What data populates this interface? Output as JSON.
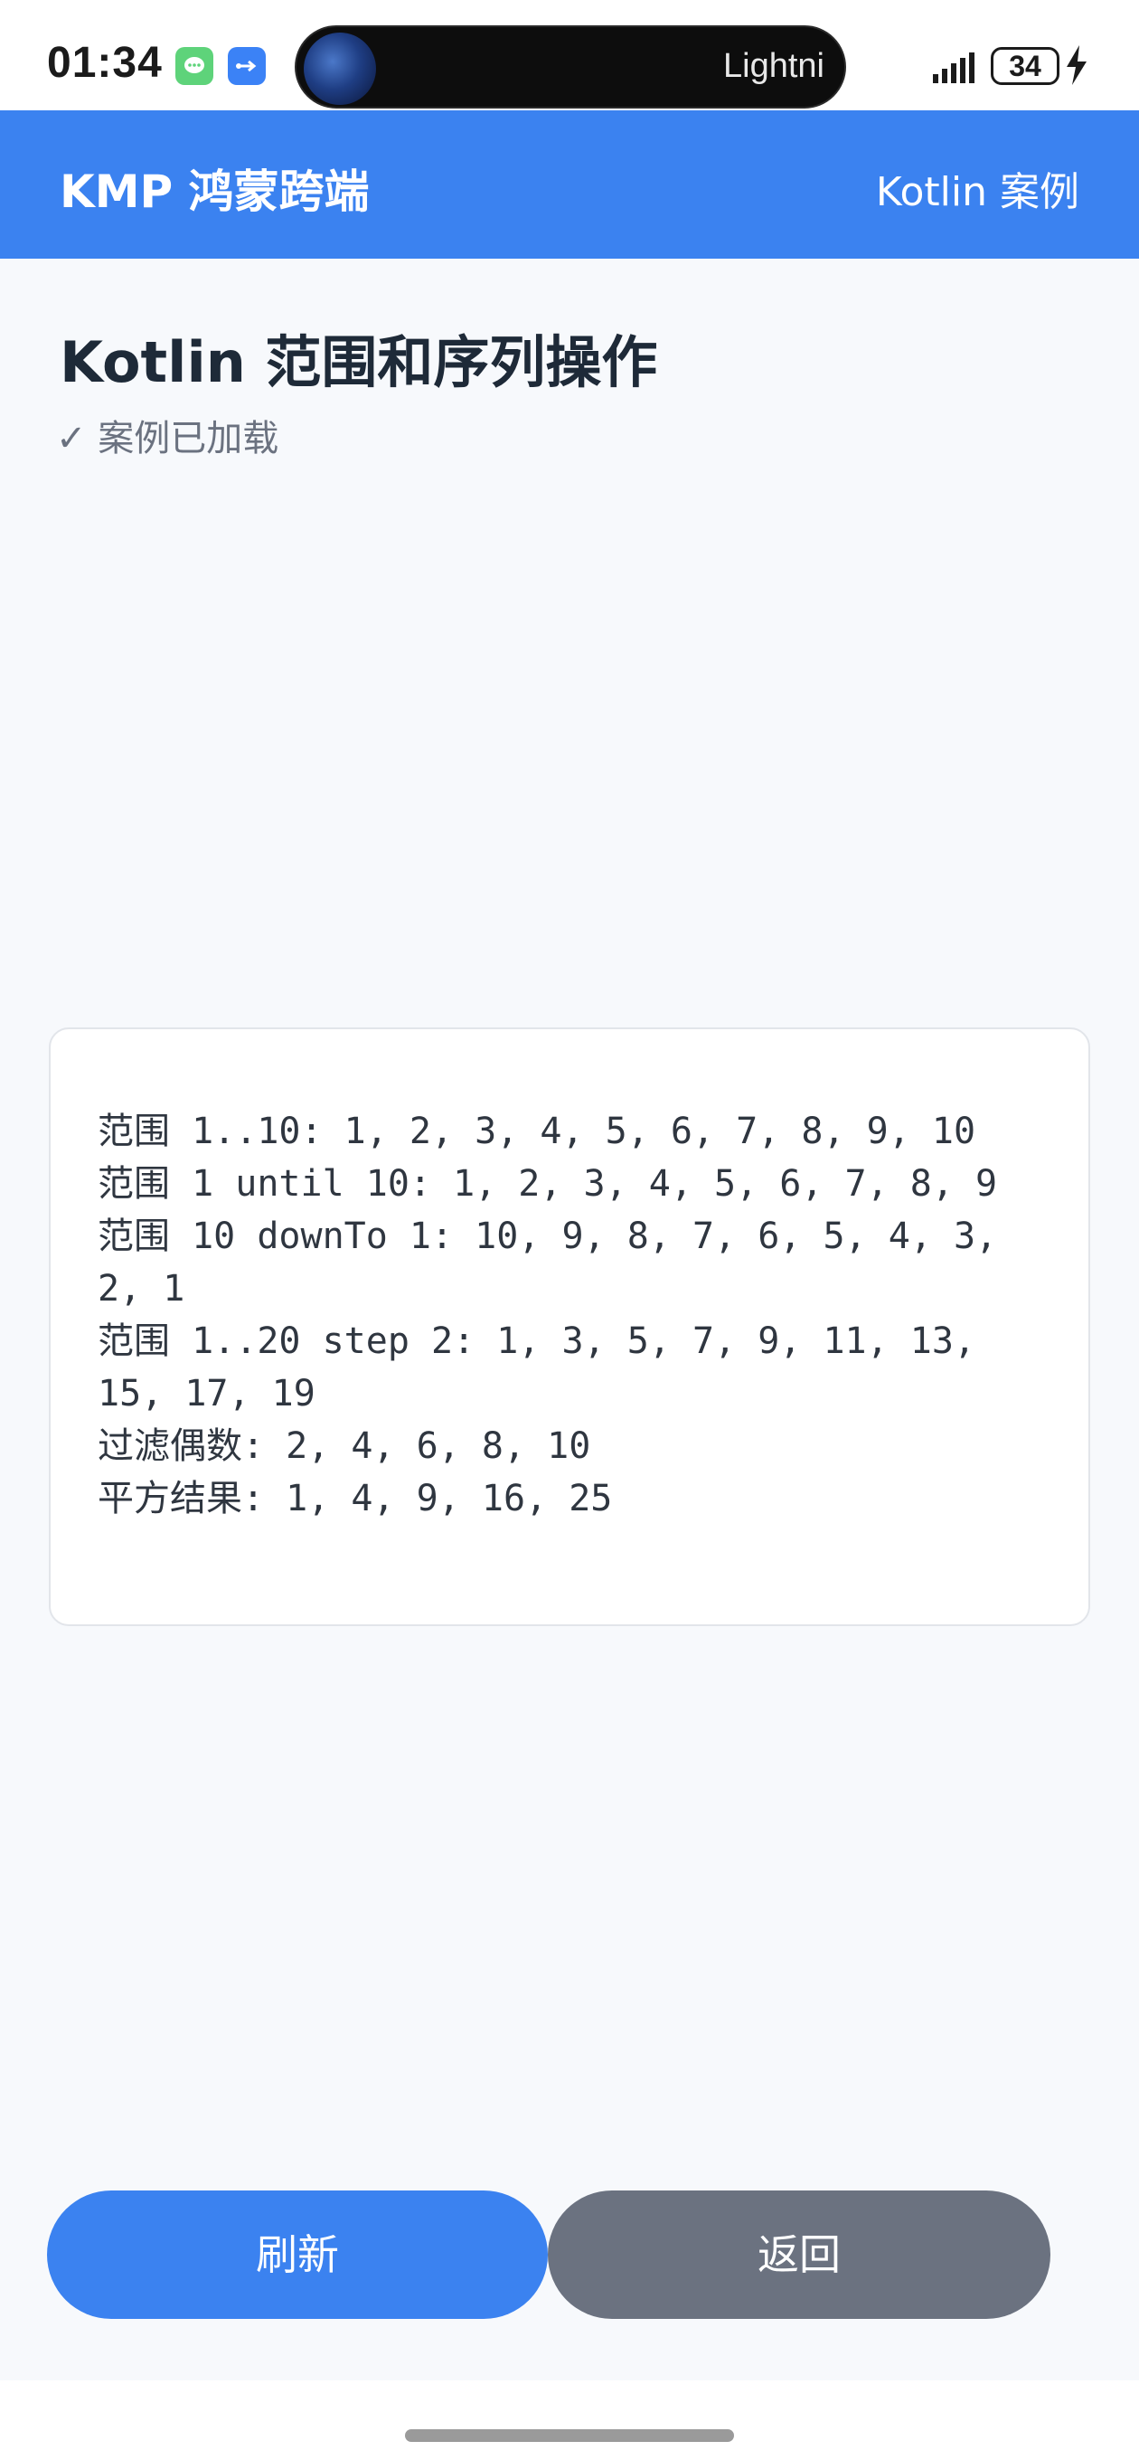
{
  "status_bar": {
    "time": "01:34",
    "island_text": "Lightni",
    "battery": "34",
    "icons": [
      "message-icon",
      "usb-icon",
      "signal-icon",
      "battery-icon",
      "charging-bolt-icon"
    ]
  },
  "header": {
    "title": "KMP 鸿蒙跨端",
    "right_label": "Kotlin 案例"
  },
  "main": {
    "title": "Kotlin 范围和序列操作",
    "status": "✓ 案例已加载",
    "output_lines": [
      "范围 1..10: 1, 2, 3, 4, 5, 6, 7, 8, 9, 10",
      "范围 1 until 10: 1, 2, 3, 4, 5, 6, 7, 8, 9",
      "范围 10 downTo 1: 10, 9, 8, 7, 6, 5, 4, 3, 2, 1",
      "范围 1..20 step 2: 1, 3, 5, 7, 9, 11, 13, 15, 17, 19",
      "过滤偶数: 2, 4, 6, 8, 10",
      "平方结果: 1, 4, 9, 16, 25"
    ]
  },
  "buttons": {
    "refresh": "刷新",
    "back": "返回"
  },
  "colors": {
    "accent": "#3b82f0",
    "secondary_button": "#6b7280",
    "background": "#f7f9fc"
  }
}
